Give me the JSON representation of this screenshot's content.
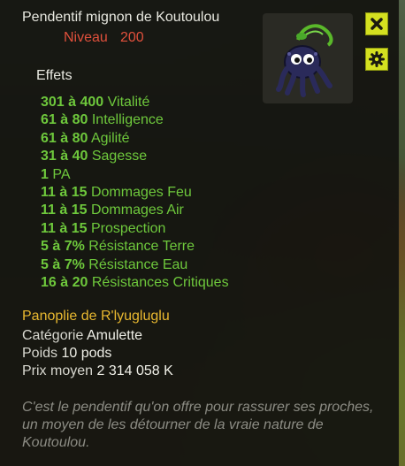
{
  "item": {
    "name": "Pendentif mignon de Koutoulou",
    "level_label": "Niveau",
    "level_value": "200"
  },
  "effects_title": "Effets",
  "effects": [
    {
      "range": "301 à 400",
      "stat": "Vitalité"
    },
    {
      "range": "61 à 80",
      "stat": "Intelligence"
    },
    {
      "range": "61 à 80",
      "stat": "Agilité"
    },
    {
      "range": "31 à 40",
      "stat": "Sagesse"
    },
    {
      "range": "1",
      "stat": "PA"
    },
    {
      "range": "11 à 15",
      "stat": "Dommages Feu"
    },
    {
      "range": "11 à 15",
      "stat": "Dommages Air"
    },
    {
      "range": "11 à 15",
      "stat": "Prospection"
    },
    {
      "range": "5 à 7%",
      "stat": "Résistance Terre"
    },
    {
      "range": "5 à 7%",
      "stat": "Résistance Eau"
    },
    {
      "range": "16 à 20",
      "stat": "Résistances Critiques"
    }
  ],
  "set_name": "Panoplie de R'lyugluglu",
  "category": {
    "label": "Catégorie",
    "value": "Amulette"
  },
  "weight": {
    "label": "Poids",
    "value": "10 pods"
  },
  "price": {
    "label": "Prix moyen",
    "value": "2 314 058 K"
  },
  "description": "C'est le pendentif qu'on offre pour rassurer ses proches, un moyen de les détourner de la vraie nature de Koutoulou.",
  "icons": {
    "close": "close-icon",
    "settings": "gear-icon",
    "item": "octopus-amulet-icon"
  },
  "colors": {
    "accent_button": "#d4e020",
    "level": "#e0503c",
    "effect": "#6ec83c",
    "set": "#e8b830",
    "description": "#8c8c84"
  }
}
